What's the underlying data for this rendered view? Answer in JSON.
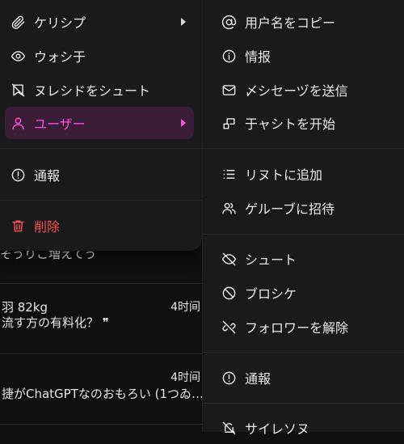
{
  "left_menu": {
    "items": [
      {
        "label": "ケリシプ",
        "icon": "paperclip-icon",
        "submenu": true
      },
      {
        "label": "ウォシ于",
        "icon": "eye-icon"
      },
      {
        "label": "ヌレシドをシュート",
        "icon": "bookmark-slash-icon"
      },
      {
        "label": "ユーザー",
        "icon": "user-icon",
        "submenu": true,
        "active": true
      },
      {
        "label": "通報",
        "icon": "alert-circle-icon"
      },
      {
        "label": "削除",
        "icon": "trash-icon",
        "danger": true
      }
    ]
  },
  "right_menu": {
    "items": [
      {
        "label": "用户名をコピー",
        "icon": "at-icon"
      },
      {
        "label": "情报",
        "icon": "info-icon"
      },
      {
        "label": "〆シセーヅを送信",
        "icon": "mail-icon"
      },
      {
        "label": "于ャシトを开始",
        "icon": "chat-start-icon"
      },
      {
        "label": "リヌトに追加",
        "icon": "list-icon"
      },
      {
        "label": "ゲルーブに招待",
        "icon": "users-icon"
      },
      {
        "label": "シュート",
        "icon": "eye-slash-icon"
      },
      {
        "label": "ブロシケ",
        "icon": "block-icon"
      },
      {
        "label": "フォロワーを解除",
        "icon": "unlink-icon"
      },
      {
        "label": "通報",
        "icon": "alert-circle-icon"
      },
      {
        "label": "サイレソヌ",
        "icon": "bell-off-icon"
      }
    ]
  },
  "feed": {
    "rows": [
      {
        "text": "そうりこ増えてう"
      },
      {
        "name": "羽 82kg",
        "time": "4时间",
        "text": "流す方の有料化？ ❞"
      },
      {
        "name": "",
        "time": "4时间",
        "text": "捷がChatGPTなのおもろい (1つゐ…"
      }
    ]
  },
  "colors": {
    "accent": "#ff4fe1",
    "danger": "#ff4d4d",
    "menu_bg": "#1a1a1c"
  }
}
